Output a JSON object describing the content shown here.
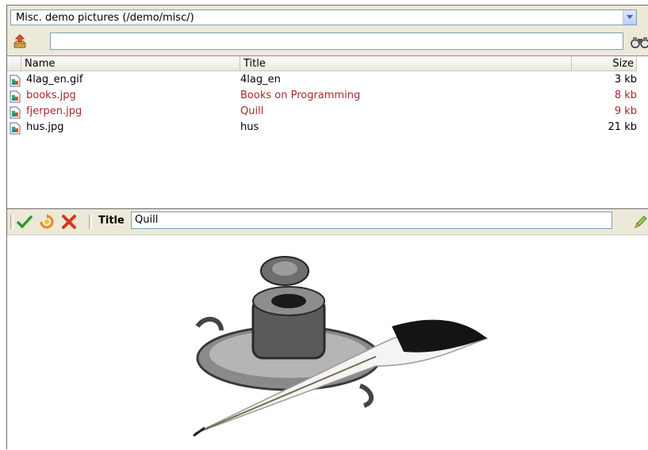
{
  "folder_select": {
    "value": "Misc. demo pictures (/demo/misc/)"
  },
  "search": {
    "value": "",
    "placeholder": ""
  },
  "file_list": {
    "columns": {
      "name": "Name",
      "title": "Title",
      "size": "Size"
    },
    "rows": [
      {
        "name": "4lag_en.gif",
        "title": "4lag_en",
        "size": "3 kb",
        "highlighted": false
      },
      {
        "name": "books.jpg",
        "title": "Books on Programming",
        "size": "8 kb",
        "highlighted": true
      },
      {
        "name": "fjerpen.jpg",
        "title": "Quill",
        "size": "9 kb",
        "highlighted": true
      },
      {
        "name": "hus.jpg",
        "title": "hus",
        "size": "21 kb",
        "highlighted": false
      }
    ]
  },
  "edit_bar": {
    "title_label": "Title",
    "title_value": "Quill",
    "icons": [
      "save-check-icon",
      "refresh-icon",
      "delete-x-icon",
      "pencil-icon"
    ]
  },
  "preview": {
    "image": "inkwell-quill-picture"
  },
  "colors": {
    "highlight_text": "#a5282d",
    "toolbar_bg": "#ece9d8",
    "input_border": "#7f9db9"
  }
}
